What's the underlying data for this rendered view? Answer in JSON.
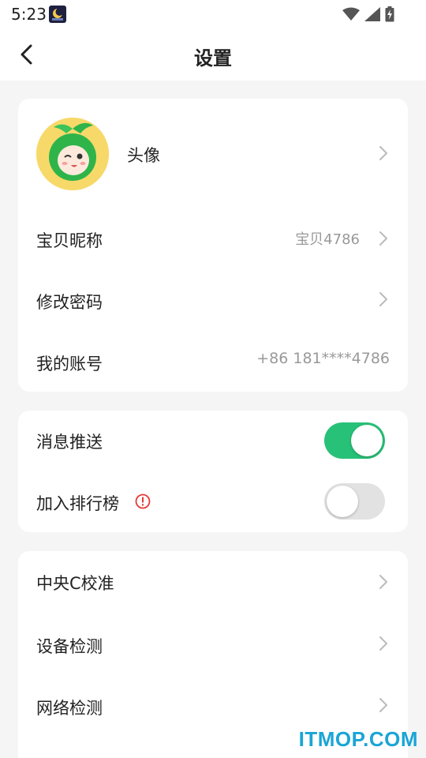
{
  "status_bar": {
    "time": "5:23",
    "notification_icon": "moon-icon",
    "icons": [
      "wifi-icon",
      "signal-icon",
      "battery-charging-icon"
    ]
  },
  "header": {
    "title": "设置",
    "back_icon": "chevron-left-icon"
  },
  "profile_card": {
    "avatar": {
      "label": "头像"
    },
    "nickname": {
      "label": "宝贝昵称",
      "value": "宝贝4786"
    },
    "password": {
      "label": "修改密码"
    },
    "account": {
      "label": "我的账号",
      "value": "+86 181****4786"
    }
  },
  "toggles_card": {
    "push": {
      "label": "消息推送",
      "enabled": true
    },
    "ranking": {
      "label": "加入排行榜",
      "enabled": false,
      "info_icon": "alert-circle-icon"
    }
  },
  "tools_card": {
    "items": [
      {
        "label": "中央C校准"
      },
      {
        "label": "设备检测"
      },
      {
        "label": "网络检测"
      }
    ]
  },
  "watermark": "ITMOP.COM",
  "colors": {
    "accent_green": "#28c178",
    "warning_red": "#e53935",
    "page_bg": "#f5f5f5",
    "card_bg": "#ffffff",
    "watermark": "#1aa5d6"
  }
}
